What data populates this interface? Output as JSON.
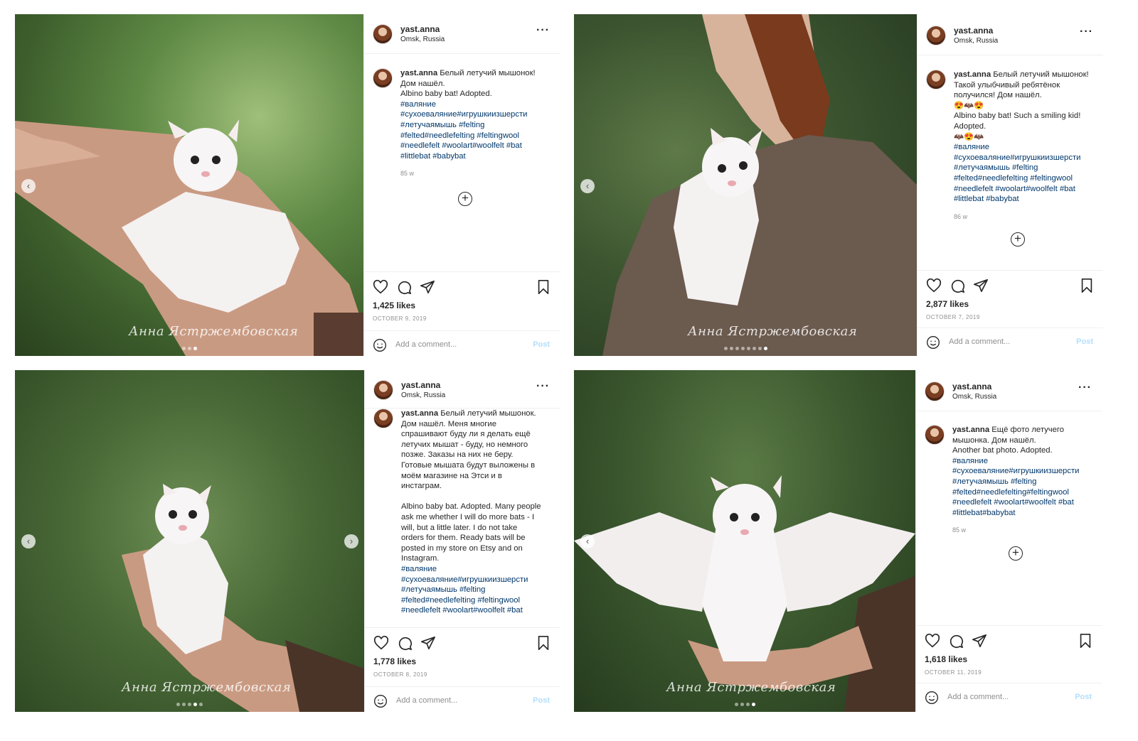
{
  "posts": [
    {
      "username": "yast.anna",
      "location": "Omsk, Russia",
      "caption": "Белый летучий мышонок!\nДом нашёл.\nAlbino baby bat! Adopted.",
      "hashtags": "#валяние\n#сухоеваляние#игрушкиизшерсти\n#летучаямышь #felting\n#felted#needlefelting #feltingwool\n#needlefelt #woolart#woolfelt #bat\n#littlebat #babybat",
      "age": "85 w",
      "likes": "1,425 likes",
      "date": "OCTOBER 9, 2019",
      "comment_placeholder": "Add a comment...",
      "post_label": "Post",
      "watermark": "Анна Ястржембовская"
    },
    {
      "username": "yast.anna",
      "location": "Omsk, Russia",
      "caption": "Белый летучий мышонок!\nТакой улыбчивый ребятёнок\nполучился! Дом нашёл.\n😍🦇😍\nAlbino baby bat! Such a smiling kid!\nAdopted.\n🦇😍🦇",
      "hashtags": "#валяние\n#сухоеваляние#игрушкиизшерсти\n#летучаямышь #felting\n#felted#needlefelting #feltingwool\n#needlefelt #woolart#woolfelt #bat\n#littlebat #babybat",
      "age": "86 w",
      "likes": "2,877 likes",
      "date": "OCTOBER 7, 2019",
      "comment_placeholder": "Add a comment...",
      "post_label": "Post",
      "watermark": "Анна Ястржембовская"
    },
    {
      "username": "yast.anna",
      "location": "Omsk, Russia",
      "caption": "Белый летучий мышонок.\nДом нашёл. Меня многие\nспрашивают буду ли я делать ещё\nлетучих мышат - буду, но немного\nпозже. Заказы на них не беру.\nГотовые мышата будут выложены в\nмоём магазине на Этси и в\nинстаграм.\n\nAlbino baby bat. Adopted. Many people\nask me whether I will do more bats - I\nwill, but a little later. I do not take\norders for them. Ready bats will be\nposted in my store on Etsy and on\nInstagram.\n",
      "hashtags": "#валяние\n#сухоеваляние#игрушкиизшерсти\n#летучаямышь #felting\n#felted#needlefelting #feltingwool\n#needlefelt #woolart#woolfelt #bat",
      "age": "",
      "likes": "1,778 likes",
      "date": "OCTOBER 8, 2019",
      "comment_placeholder": "Add a comment...",
      "post_label": "Post",
      "watermark": "Анна Ястржембовская"
    },
    {
      "username": "yast.anna",
      "location": "Omsk, Russia",
      "caption": "Ещё фото летучего\nмышонка. Дом нашёл.\nAnother bat photo. Adopted.",
      "hashtags": "#валяние\n#сухоеваляние#игрушкиизшерсти\n#летучаямышь #felting\n#felted#needlefelting#feltingwool\n#needlefelt #woolart#woolfelt #bat\n#littlebat#babybat",
      "age": "85 w",
      "likes": "1,618 likes",
      "date": "OCTOBER 11, 2019",
      "comment_placeholder": "Add a comment...",
      "post_label": "Post",
      "watermark": "Анна Ястржембовская"
    }
  ],
  "icons": {
    "more": "more-options-icon",
    "like": "heart-icon",
    "comment": "comment-icon",
    "share": "share-icon",
    "save": "bookmark-icon",
    "emoji": "smile-icon",
    "add": "plus-circle-icon",
    "prev": "chevron-left-icon",
    "next": "chevron-right-icon"
  },
  "more_glyph": "···",
  "colors": {
    "link": "#00376b",
    "muted": "#8e8e8e",
    "post_button": "#b2dffc",
    "text": "#262626"
  }
}
